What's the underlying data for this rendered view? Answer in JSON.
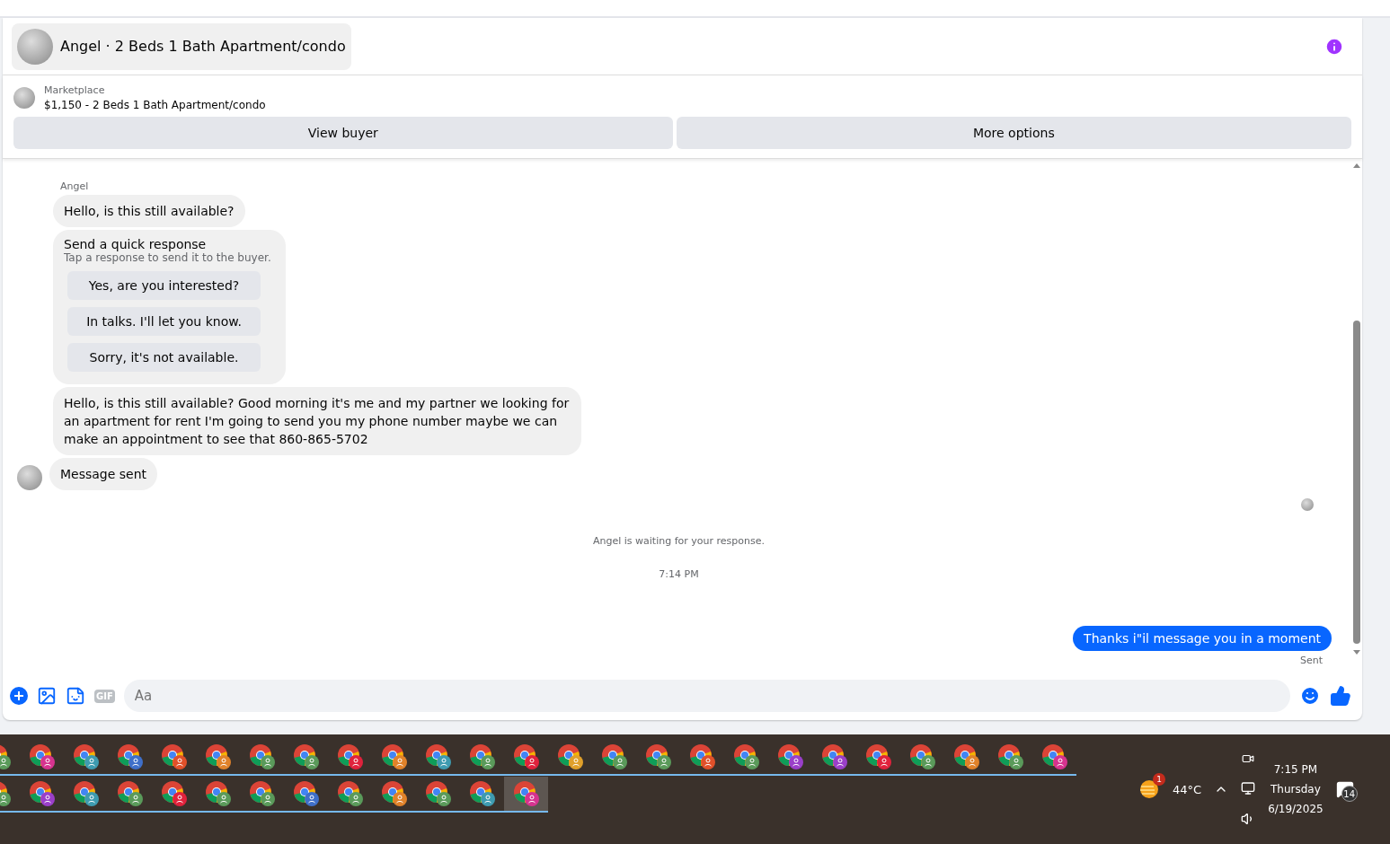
{
  "header": {
    "title": "Angel · 2 Beds 1 Bath Apartment/condo"
  },
  "listing": {
    "source": "Marketplace",
    "title": "$1,150 - 2 Beds 1 Bath Apartment/condo",
    "buttons": [
      "View buyer",
      "More options"
    ]
  },
  "chat": {
    "sender": "Angel",
    "items": [
      {
        "kind": "text",
        "text": "Hello, is this still available?",
        "avatar": false
      },
      {
        "kind": "quick",
        "title": "Send a quick response",
        "subtitle": "Tap a response to send it to the buyer.",
        "options": [
          "Yes, are you interested?",
          "In talks. I'll let you know.",
          "Sorry, it's not available."
        ]
      },
      {
        "kind": "text",
        "text": "Hello, is this still available? Good morning it's me and my partner we looking for an apartment for rent I'm going to send you my phone number maybe we can make an appointment to see that 860-865-5702",
        "avatar": false
      },
      {
        "kind": "text",
        "text": "Message sent",
        "avatar": true
      }
    ],
    "status": "Angel is waiting for your response.",
    "time": "7:14 PM",
    "outgoing": {
      "text": "Thanks i\"il message you in a moment",
      "status": "Sent"
    }
  },
  "composer": {
    "gif": "GIF",
    "placeholder": "Aa"
  },
  "taskbar": {
    "rows": [
      [
        {
          "color": "#5a9a5a",
          "selected": false
        },
        {
          "color": "#d6338f",
          "selected": false
        },
        {
          "color": "#3e9bb0",
          "selected": false
        },
        {
          "color": "#3f6fc9",
          "selected": false
        },
        {
          "color": "#e0502a",
          "selected": false
        },
        {
          "color": "#e0822a",
          "selected": false
        },
        {
          "color": "#5a9a5a",
          "selected": false
        },
        {
          "color": "#5a9a5a",
          "selected": false
        },
        {
          "color": "#e0223c",
          "selected": false
        },
        {
          "color": "#e0822a",
          "selected": false
        },
        {
          "color": "#3e9bb0",
          "selected": false
        },
        {
          "color": "#5a9a5a",
          "selected": false
        },
        {
          "color": "#e0223c",
          "selected": false
        },
        {
          "color": "#e0a02a",
          "selected": false
        },
        {
          "color": "#5a9a5a",
          "selected": false
        },
        {
          "color": "#5a9a5a",
          "selected": false
        },
        {
          "color": "#e0502a",
          "selected": false
        },
        {
          "color": "#5a9a5a",
          "selected": false
        },
        {
          "color": "#9a3fc9",
          "selected": false
        },
        {
          "color": "#9a3fc9",
          "selected": false
        },
        {
          "color": "#e0223c",
          "selected": false
        },
        {
          "color": "#5a9a5a",
          "selected": false
        },
        {
          "color": "#e0822a",
          "selected": false
        },
        {
          "color": "#5a9a5a",
          "selected": false
        },
        {
          "color": "#d6338f",
          "selected": false
        }
      ],
      [
        {
          "color": "#5a9a5a",
          "selected": false
        },
        {
          "color": "#9a3fc9",
          "selected": false
        },
        {
          "color": "#3e9bb0",
          "selected": false
        },
        {
          "color": "#5a9a5a",
          "selected": false
        },
        {
          "color": "#e0223c",
          "selected": false
        },
        {
          "color": "#5a9a5a",
          "selected": false
        },
        {
          "color": "#5a9a5a",
          "selected": false
        },
        {
          "color": "#3f6fc9",
          "selected": false
        },
        {
          "color": "#5a9a5a",
          "selected": false
        },
        {
          "color": "#e0822a",
          "selected": false
        },
        {
          "color": "#5a9a5a",
          "selected": false
        },
        {
          "color": "#3e9bb0",
          "selected": false
        },
        {
          "color": "#d6338f",
          "selected": true
        }
      ]
    ],
    "weather": {
      "temp": "44°C",
      "badge": "1"
    },
    "clock": {
      "time": "7:15 PM",
      "day": "Thursday",
      "date": "6/19/2025"
    },
    "notifications": "14"
  }
}
